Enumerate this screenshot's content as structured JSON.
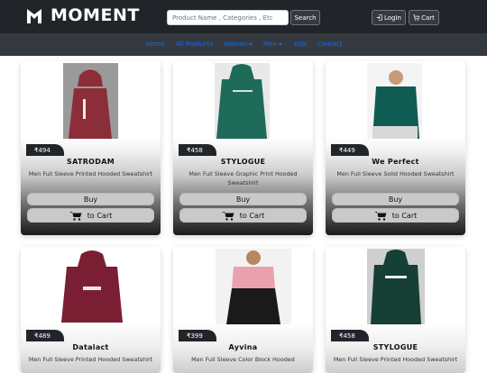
{
  "header": {
    "brand": "MOMENT",
    "search_placeholder": "Product Name , Categories , Etc",
    "search_button": "Search",
    "login_label": "LogIn",
    "cart_label": "Cart"
  },
  "nav": {
    "items": [
      {
        "label": "Home"
      },
      {
        "label": "All Products"
      },
      {
        "label": "Women"
      },
      {
        "label": "Men"
      },
      {
        "label": "Kids"
      },
      {
        "label": "Contact"
      }
    ]
  },
  "products": [
    {
      "price": "₹494",
      "name": "SATRODAM",
      "desc": "Men Full Sleeve Printed Hooded Sweatshirt",
      "buy": "Buy",
      "cart": "to Cart",
      "color": "#8b2e3a"
    },
    {
      "price": "₹458",
      "name": "STYLOGUE",
      "desc": "Men Full Sleeve Graphic Print Hooded Sweatshirt",
      "buy": "Buy",
      "cart": "to Cart",
      "color": "#1f6b5a"
    },
    {
      "price": "₹449",
      "name": "We Perfect",
      "desc": "Men Full Sleeve Solid Hooded Sweatshirt",
      "buy": "Buy",
      "cart": "to Cart",
      "color": "#0f5c52"
    },
    {
      "price": "₹489",
      "name": "Datalact",
      "desc": "Men Full Sleeve Printed Hooded Sweatshirt",
      "color": "#7a1f33"
    },
    {
      "price": "₹399",
      "name": "Ayvina",
      "desc": "Men Full Sleeve Color Block Hooded",
      "color": "#e9a2ad"
    },
    {
      "price": "₹458",
      "name": "STYLOGUE",
      "desc": "Men Full Sleeve Printed Hooded Sweatshirt",
      "color": "#163f35"
    }
  ],
  "colors": {
    "topbar": "#212529",
    "navbar": "#343a40",
    "nav_link": "#0d6efd"
  }
}
